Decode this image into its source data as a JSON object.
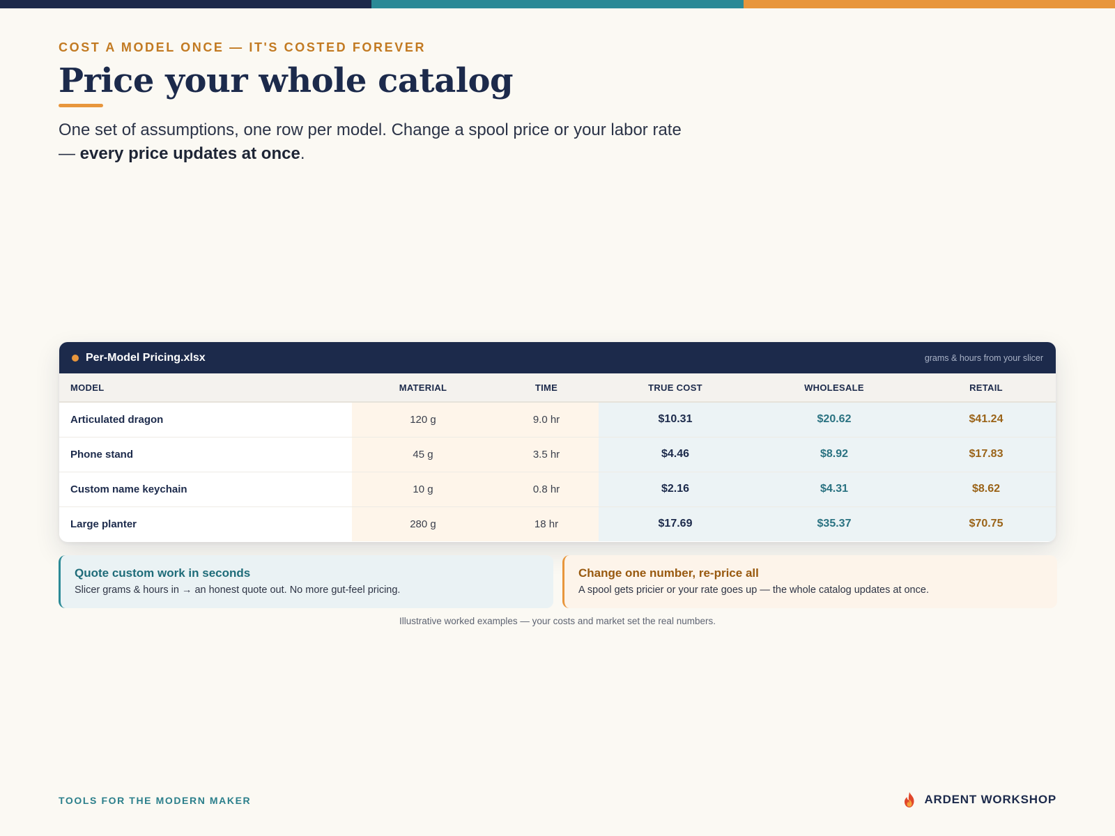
{
  "theme": {
    "navy": "#1c2a4b",
    "teal": "#2b8a96",
    "orange": "#e8963c",
    "background": "#fbf9f3"
  },
  "top_bar": {
    "colors": [
      "#1c2a4b",
      "#2b8a96",
      "#e8963c"
    ]
  },
  "hero": {
    "eyebrow": "COST A MODEL ONCE — IT'S COSTED FOREVER",
    "title": "Price your whole catalog",
    "subtitle_part1": "One set of assumptions, one row per model. Change a spool price or your labor rate — ",
    "subtitle_bold": "every price updates at once",
    "subtitle_end": "."
  },
  "sheet": {
    "filename": "Per-Model Pricing.xlsx",
    "hint": "grams & hours from your slicer",
    "columns": [
      "MODEL",
      "MATERIAL",
      "TIME",
      "TRUE COST",
      "WHOLESALE",
      "RETAIL"
    ],
    "rows": [
      {
        "model": "Articulated dragon",
        "material": "120 g",
        "time": "9.0 hr",
        "true_cost": "$10.31",
        "wholesale": "$20.62",
        "retail": "$41.24"
      },
      {
        "model": "Phone stand",
        "material": "45 g",
        "time": "3.5 hr",
        "true_cost": "$4.46",
        "wholesale": "$8.92",
        "retail": "$17.83"
      },
      {
        "model": "Custom name keychain",
        "material": "10 g",
        "time": "0.8 hr",
        "true_cost": "$2.16",
        "wholesale": "$4.31",
        "retail": "$8.62"
      },
      {
        "model": "Large planter",
        "material": "280 g",
        "time": "18 hr",
        "true_cost": "$17.69",
        "wholesale": "$35.37",
        "retail": "$70.75"
      }
    ]
  },
  "callouts": {
    "quote": {
      "title": "Quote custom work in seconds",
      "body": "Slicer grams & hours in → an honest quote out. No more gut-feel pricing."
    },
    "reprice": {
      "title": "Change one number, re-price all",
      "body": "A spool gets pricier or your rate goes up — the whole catalog updates at once."
    }
  },
  "footnote": "Illustrative worked examples — your costs and market set the real numbers.",
  "footer": {
    "tagline": "TOOLS FOR THE MODERN MAKER",
    "brand_icon": "flame-icon",
    "brand_name": "ARDENT WORKSHOP"
  }
}
